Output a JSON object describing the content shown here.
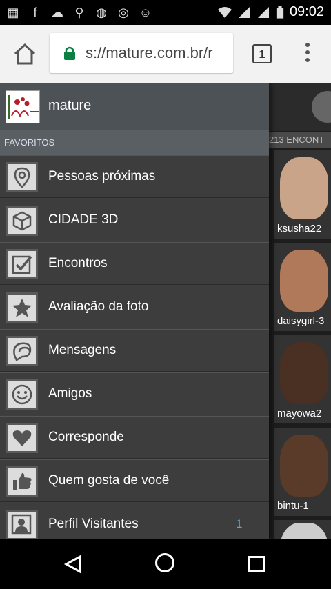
{
  "status_bar": {
    "time": "09:02",
    "notification_icons": [
      "message-icon",
      "facebook-icon",
      "cloud-icon",
      "rake-icon",
      "messenger-icon",
      "whatsapp-icon",
      "emoji-icon"
    ]
  },
  "browser": {
    "url": "s://mature.com.br/r",
    "tab_count": "1"
  },
  "drawer": {
    "title": "mature",
    "section": "FAVORITOS",
    "items": [
      {
        "label": "Pessoas próximas",
        "icon": "location-pin-icon",
        "badge": ""
      },
      {
        "label": "CIDADE 3D",
        "icon": "cube-icon",
        "badge": ""
      },
      {
        "label": "Encontros",
        "icon": "checkmark-icon",
        "badge": ""
      },
      {
        "label": "Avaliação da foto",
        "icon": "star-icon",
        "badge": ""
      },
      {
        "label": "Mensagens",
        "icon": "chat-bubbles-icon",
        "badge": ""
      },
      {
        "label": "Amigos",
        "icon": "smiley-icon",
        "badge": ""
      },
      {
        "label": "Corresponde",
        "icon": "heart-icon",
        "badge": ""
      },
      {
        "label": "Quem gosta de você",
        "icon": "thumbs-up-icon",
        "badge": ""
      },
      {
        "label": "Perfil Visitantes",
        "icon": "visitors-icon",
        "badge": "1"
      }
    ]
  },
  "background": {
    "count_text": "213 ENCONT",
    "profiles": [
      {
        "name": "ksusha22"
      },
      {
        "name": "daisygirl-3"
      },
      {
        "name": "mayowa2"
      },
      {
        "name": "bintu-1"
      }
    ]
  }
}
